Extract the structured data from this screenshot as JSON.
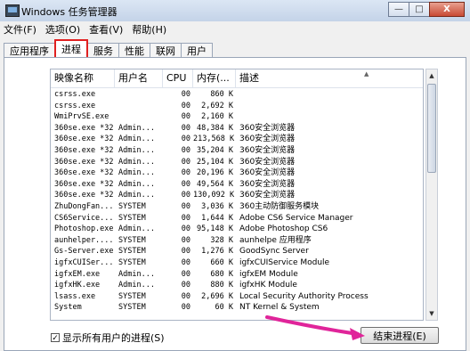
{
  "window": {
    "title": "Windows 任务管理器",
    "minimize": "—",
    "maximize": "□",
    "close": "X"
  },
  "menu": [
    "文件(F)",
    "选项(O)",
    "查看(V)",
    "帮助(H)"
  ],
  "tabs": [
    "应用程序",
    "进程",
    "服务",
    "性能",
    "联网",
    "用户"
  ],
  "table": {
    "columns": [
      "映像名称",
      "用户名",
      "CPU",
      "内存(...",
      "描述"
    ],
    "rows": [
      [
        "csrss.exe",
        "",
        "00",
        "860 K",
        ""
      ],
      [
        "csrss.exe",
        "",
        "00",
        "2,692 K",
        ""
      ],
      [
        "WmiPrvSE.exe",
        "",
        "00",
        "2,160 K",
        ""
      ],
      [
        "360se.exe *32",
        "Admin...",
        "00",
        "48,384 K",
        "360安全浏览器"
      ],
      [
        "360se.exe *32",
        "Admin...",
        "00",
        "213,568 K",
        "360安全浏览器"
      ],
      [
        "360se.exe *32",
        "Admin...",
        "00",
        "35,204 K",
        "360安全浏览器"
      ],
      [
        "360se.exe *32",
        "Admin...",
        "00",
        "25,104 K",
        "360安全浏览器"
      ],
      [
        "360se.exe *32",
        "Admin...",
        "00",
        "20,196 K",
        "360安全浏览器"
      ],
      [
        "360se.exe *32",
        "Admin...",
        "00",
        "49,564 K",
        "360安全浏览器"
      ],
      [
        "360se.exe *32",
        "Admin...",
        "00",
        "130,092 K",
        "360安全浏览器"
      ],
      [
        "ZhuDongFan...",
        "SYSTEM",
        "00",
        "3,036 K",
        "360主动防御服务模块"
      ],
      [
        "CS6Service...",
        "SYSTEM",
        "00",
        "1,644 K",
        "Adobe CS6 Service Manager"
      ],
      [
        "Photoshop.exe",
        "Admin...",
        "00",
        "95,148 K",
        "Adobe Photoshop CS6"
      ],
      [
        "aunhelper....",
        "SYSTEM",
        "00",
        "328 K",
        "aunhelpe 应用程序"
      ],
      [
        "Gs-Server.exe",
        "SYSTEM",
        "00",
        "1,276 K",
        "GoodSync Server"
      ],
      [
        "igfxCUISer...",
        "SYSTEM",
        "00",
        "660 K",
        "igfxCUIService Module"
      ],
      [
        "igfxEM.exe",
        "Admin...",
        "00",
        "680 K",
        "igfxEM Module"
      ],
      [
        "igfxHK.exe",
        "Admin...",
        "00",
        "880 K",
        "igfxHK Module"
      ],
      [
        "lsass.exe",
        "SYSTEM",
        "00",
        "2,696 K",
        "Local Security Authority Process"
      ],
      [
        "System",
        "SYSTEM",
        "00",
        "60 K",
        "NT Kernel & System"
      ]
    ]
  },
  "show_all_users_label": "显示所有用户的进程(S)",
  "show_all_users_checked": true,
  "end_process_label": "结束进程(E)",
  "colors": {
    "highlight": "#e02020",
    "arrow": "#e0259a"
  }
}
